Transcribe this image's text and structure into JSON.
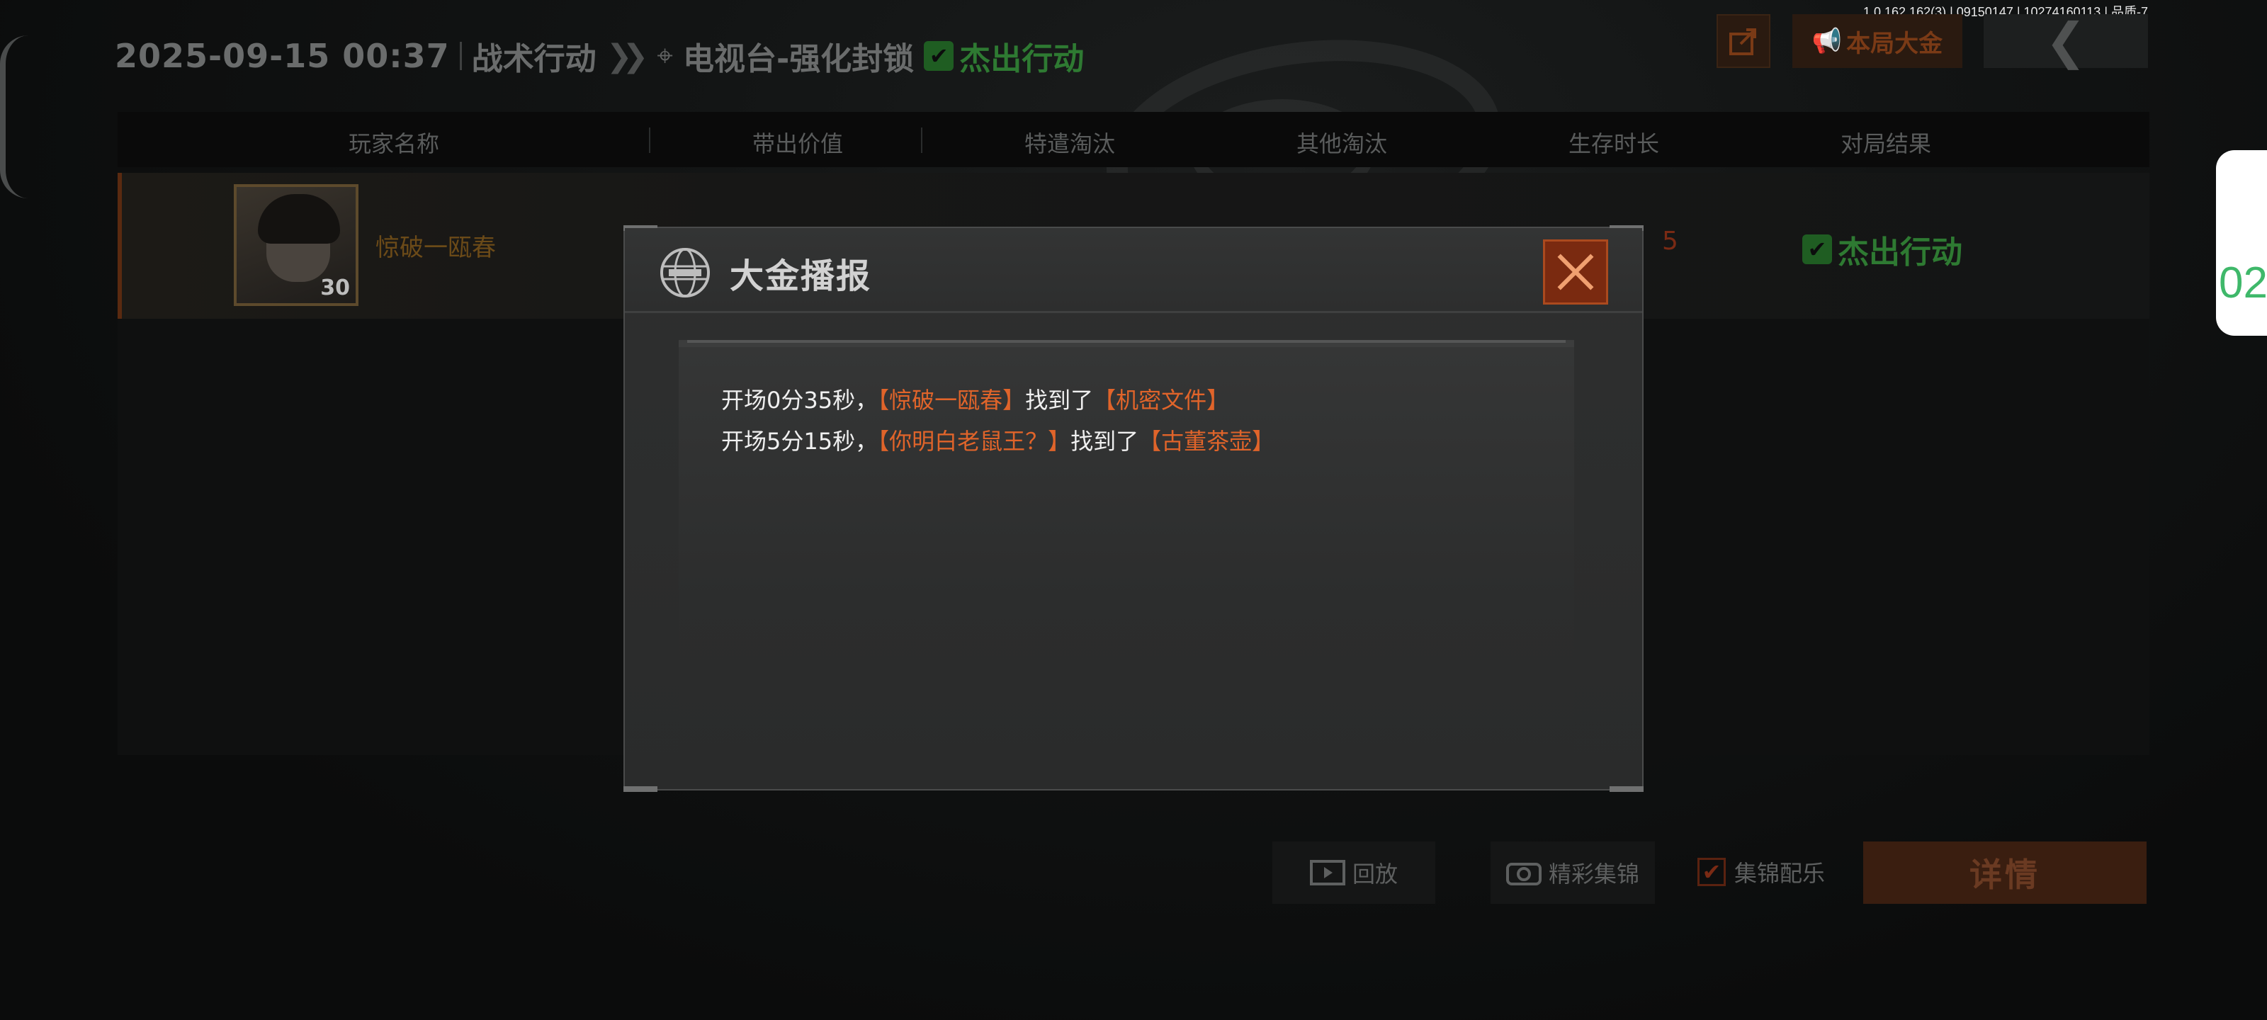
{
  "version_info": "1.0.162.162(3) | 09150147 | 10274160113 | 品质-7",
  "header": {
    "date": "2025-09-15 00:37",
    "mode": "战术行动",
    "chevrons": "❯❯",
    "map_icon": "⌖",
    "map": "电视台-强化封锁",
    "result": "杰出行动",
    "check": "✔"
  },
  "top_buttons": {
    "share_icon": "share-icon",
    "gold_label": "本局大金",
    "gold_icon": "📢",
    "back_icon": "❮"
  },
  "table": {
    "columns": [
      "玩家名称",
      "带出价值",
      "特遣淘汰",
      "其他淘汰",
      "生存时长",
      "对局结果"
    ],
    "row": {
      "player_name": "惊破一瓯春",
      "level": "30",
      "value": "5",
      "result": "杰出行动"
    }
  },
  "bottom": {
    "replay_label": "回放",
    "highlight_label": "精彩集锦",
    "music_label": "集锦配乐",
    "detail_label": "详情"
  },
  "right_tab_text": "02",
  "dialog": {
    "title": "大金播报",
    "lines": [
      {
        "prefix": "开场0分35秒，",
        "player": "【惊破一瓯春】",
        "verb": "找到了",
        "item": "【机密文件】"
      },
      {
        "prefix": "开场5分15秒，",
        "player": "【你明白老鼠王？】",
        "verb": "找到了",
        "item": "【古董茶壶】"
      }
    ]
  },
  "colors": {
    "accent_orange": "#e0642a",
    "success_green": "#2e7a32",
    "close_button": "#7a2a10"
  }
}
